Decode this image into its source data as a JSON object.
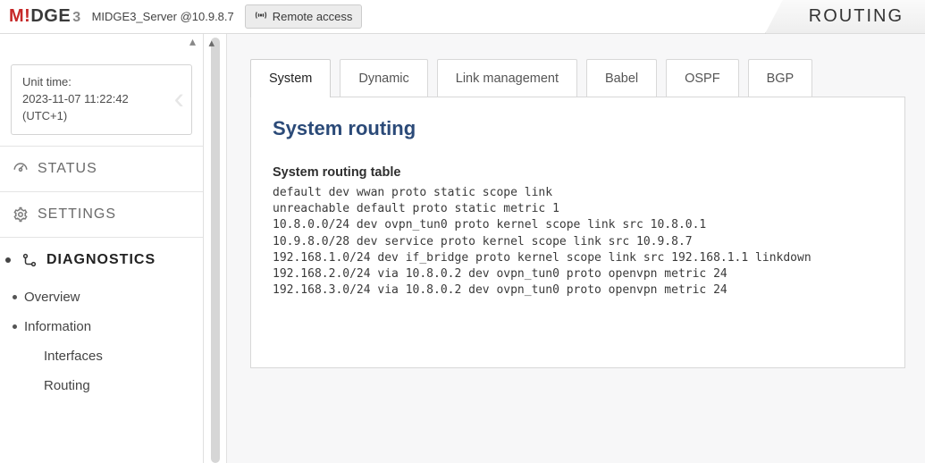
{
  "header": {
    "logo_prefix": "M",
    "logo_accent": "!",
    "logo_mid": "DGE",
    "logo_suffix": "3",
    "server": "MIDGE3_Server @10.9.8.7",
    "remote_label": "Remote access",
    "page_title": "ROUTING"
  },
  "timebox": {
    "label": "Unit time:",
    "time": "2023-11-07 11:22:42",
    "tz": "(UTC+1)"
  },
  "sidebar": {
    "status": "STATUS",
    "settings": "SETTINGS",
    "diagnostics": "DIAGNOSTICS",
    "items": [
      {
        "label": "Overview",
        "level": 2
      },
      {
        "label": "Information",
        "level": 2
      },
      {
        "label": "Interfaces",
        "level": 3
      },
      {
        "label": "Routing",
        "level": 3
      }
    ]
  },
  "tabs": [
    {
      "label": "System",
      "active": true
    },
    {
      "label": "Dynamic",
      "active": false
    },
    {
      "label": "Link management",
      "active": false
    },
    {
      "label": "Babel",
      "active": false
    },
    {
      "label": "OSPF",
      "active": false
    },
    {
      "label": "BGP",
      "active": false
    }
  ],
  "panel": {
    "heading": "System routing",
    "subheading": "System routing table",
    "lines": [
      "default dev wwan proto static scope link",
      "unreachable default proto static metric 1",
      "10.8.0.0/24 dev ovpn_tun0 proto kernel scope link src 10.8.0.1",
      "10.9.8.0/28 dev service proto kernel scope link src 10.9.8.7",
      "192.168.1.0/24 dev if_bridge proto kernel scope link src 192.168.1.1 linkdown",
      "192.168.2.0/24 via 10.8.0.2 dev ovpn_tun0 proto openvpn metric 24",
      "192.168.3.0/24 via 10.8.0.2 dev ovpn_tun0 proto openvpn metric 24"
    ]
  }
}
